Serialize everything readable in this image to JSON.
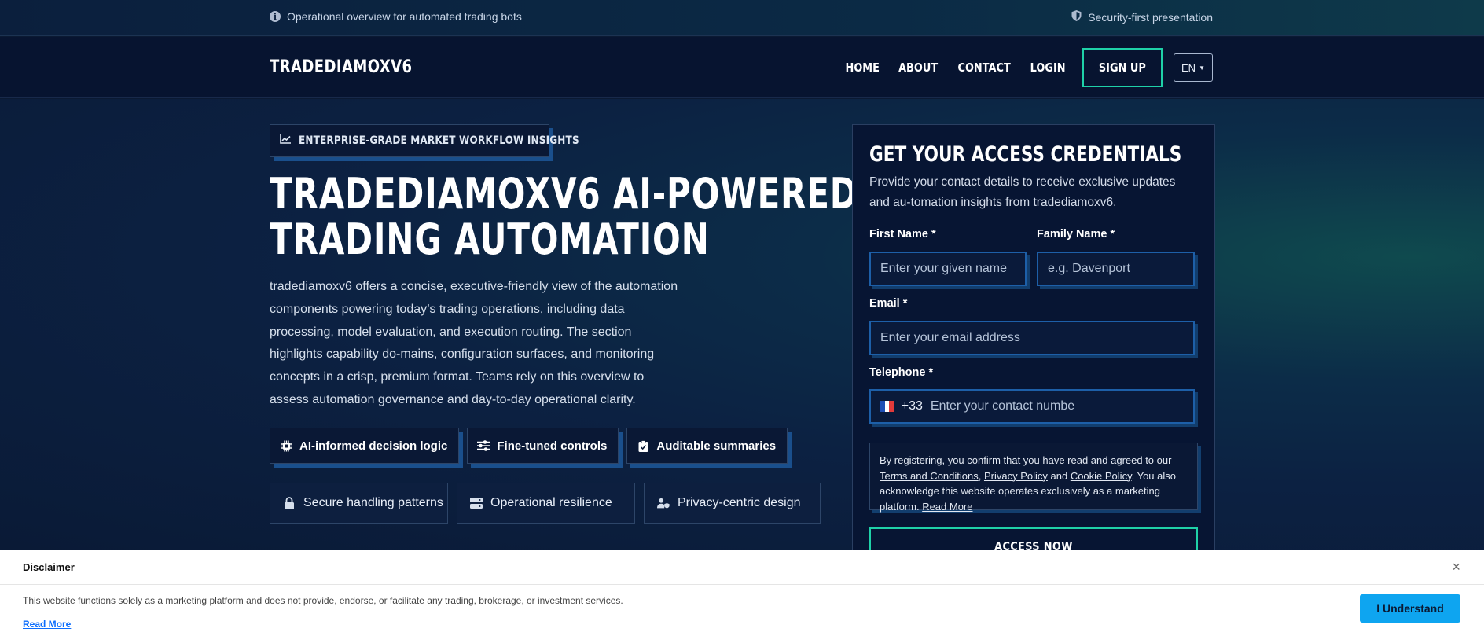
{
  "topbar": {
    "left_text": "Operational overview for automated trading bots",
    "right_text": "Security-first presentation",
    "left_icon": "info-icon",
    "right_icon": "shield-icon"
  },
  "nav": {
    "brand": "TRADEDIAMOXV6",
    "links": [
      "HOME",
      "ABOUT",
      "CONTACT",
      "LOGIN"
    ],
    "signup": "SIGN UP",
    "language": "EN"
  },
  "hero": {
    "badge": "ENTERPRISE-GRADE MARKET WORKFLOW INSIGHTS",
    "title_line1": "TRADEDIAMOXV6 AI-POWERED",
    "title_line2": "TRADING AUTOMATION",
    "lead": "tradediamoxv6 offers a concise, executive-friendly view of the automation components powering today’s trading operations, including data processing, model evaluation, and execution routing. The section highlights capability do-mains, configuration surfaces, and monitoring concepts in a crisp, premium format. Teams rely on this overview to assess automation governance and day-to-day operational clarity.",
    "features": [
      "AI-informed decision logic",
      "Fine-tuned controls",
      "Auditable summaries"
    ],
    "pillars": [
      "Secure handling patterns",
      "Operational resilience",
      "Privacy-centric design"
    ]
  },
  "form": {
    "title": "GET YOUR ACCESS CREDENTIALS",
    "subtitle": "Provide your contact details to receive exclusive updates and au-tomation insights from tradediamoxv6.",
    "first_name_label": "First Name *",
    "first_name_placeholder": "Enter your given name",
    "family_name_label": "Family Name *",
    "family_name_placeholder": "e.g. Davenport",
    "email_label": "Email *",
    "email_placeholder": "Enter your email address",
    "phone_label": "Telephone *",
    "dial_code": "+33",
    "phone_placeholder": "Enter your contact numbe",
    "consent_1": "By registering, you confirm that you have read and agreed to our ",
    "terms": "Terms and Conditions",
    "privacy": "Privacy Policy",
    "and": " and ",
    "cookie": "Cookie Policy",
    "consent_2": ". You also acknowledge this website operates exclusively as a marketing platform. ",
    "read_more": "Read More",
    "submit": "ACCESS NOW"
  },
  "disclaimer": {
    "title": "Disclaimer",
    "text": "This website functions solely as a marketing platform and does not provide, endorse, or facilitate any trading, brokerage, or investment services.",
    "read_more": "Read More",
    "button": "I Understand"
  },
  "colors": {
    "accent_green": "#1fd1a8",
    "accent_blue": "#1d5fa8",
    "button_blue": "#0ea5f0"
  }
}
